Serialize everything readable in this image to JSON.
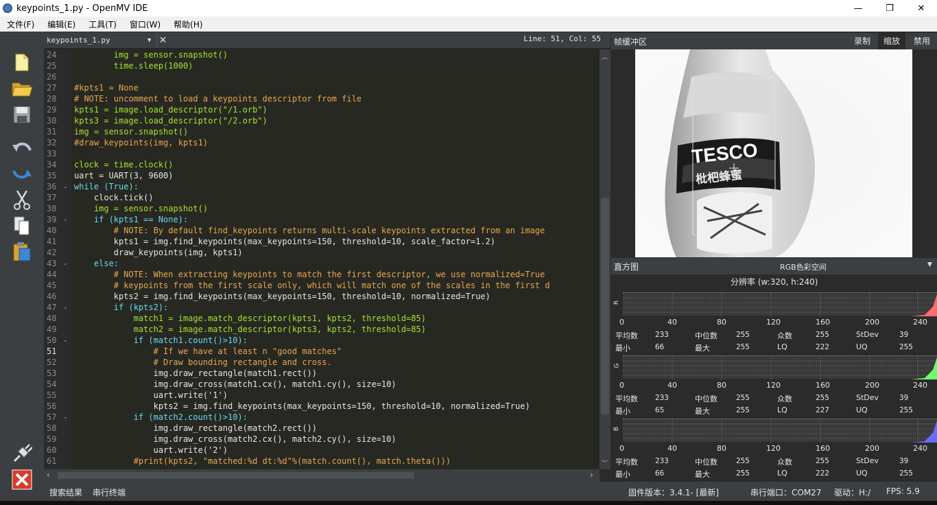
{
  "window": {
    "title": "keypoints_1.py - OpenMV IDE",
    "minimize": "—",
    "restore": "❐",
    "close": "✕"
  },
  "menu": [
    {
      "label": "文件(F)"
    },
    {
      "label": "编辑(E)"
    },
    {
      "label": "工具(T)"
    },
    {
      "label": "窗口(W)"
    },
    {
      "label": "帮助(H)"
    }
  ],
  "toolbar_icons": [
    "new-file-icon",
    "open-folder-icon",
    "save-icon",
    "undo-icon",
    "redo-icon",
    "cut-icon",
    "copy-icon",
    "paste-icon",
    "connect-icon",
    "disconnect-icon"
  ],
  "editor": {
    "file_tab": "keypoints_1.py",
    "close": "✕",
    "line_col": "Line: 51, Col: 55",
    "lines": [
      {
        "n": "24",
        "t": "        img = sensor.snapshot()"
      },
      {
        "n": "25",
        "t": "        time.sleep(1000)"
      },
      {
        "n": "26",
        "t": ""
      },
      {
        "n": "27",
        "t": "#kpts1 = None"
      },
      {
        "n": "28",
        "t": "# NOTE: uncomment to load a keypoints descriptor from file"
      },
      {
        "n": "29",
        "t": "kpts1 = image.load_descriptor(\"/1.orb\")"
      },
      {
        "n": "30",
        "t": "kpts3 = image.load_descriptor(\"/2.orb\")"
      },
      {
        "n": "31",
        "t": "img = sensor.snapshot()"
      },
      {
        "n": "32",
        "t": "#draw_keypoints(img, kpts1)"
      },
      {
        "n": "33",
        "t": ""
      },
      {
        "n": "34",
        "t": "clock = time.clock()"
      },
      {
        "n": "35",
        "t": "uart = UART(3, 9600)"
      },
      {
        "n": "36",
        "t": "while (True):"
      },
      {
        "n": "37",
        "t": "    clock.tick()"
      },
      {
        "n": "38",
        "t": "    img = sensor.snapshot()"
      },
      {
        "n": "39",
        "t": "    if (kpts1 == None):"
      },
      {
        "n": "40",
        "t": "        # NOTE: By default find_keypoints returns multi-scale keypoints extracted from an image"
      },
      {
        "n": "41",
        "t": "        kpts1 = img.find_keypoints(max_keypoints=150, threshold=10, scale_factor=1.2)"
      },
      {
        "n": "42",
        "t": "        draw_keypoints(img, kpts1)"
      },
      {
        "n": "43",
        "t": "    else:"
      },
      {
        "n": "44",
        "t": "        # NOTE: When extracting keypoints to match the first descriptor, we use normalized=True"
      },
      {
        "n": "45",
        "t": "        # keypoints from the first scale only, which will match one of the scales in the first d"
      },
      {
        "n": "46",
        "t": "        kpts2 = img.find_keypoints(max_keypoints=150, threshold=10, normalized=True)"
      },
      {
        "n": "47",
        "t": "        if (kpts2):"
      },
      {
        "n": "48",
        "t": "            match1 = image.match_descriptor(kpts1, kpts2, threshold=85)"
      },
      {
        "n": "49",
        "t": "            match2 = image.match_descriptor(kpts3, kpts2, threshold=85)"
      },
      {
        "n": "50",
        "t": "            if (match1.count()>10):"
      },
      {
        "n": "51",
        "t": "                # If we have at least n \"good matches\""
      },
      {
        "n": "52",
        "t": "                # Draw bounding rectangle and cross."
      },
      {
        "n": "53",
        "t": "                img.draw_rectangle(match1.rect())"
      },
      {
        "n": "54",
        "t": "                img.draw_cross(match1.cx(), match1.cy(), size=10)"
      },
      {
        "n": "55",
        "t": "                uart.write('1')"
      },
      {
        "n": "56",
        "t": "                kpts2 = img.find_keypoints(max_keypoints=150, threshold=10, normalized=True)"
      },
      {
        "n": "57",
        "t": "            if (match2.count()>10):"
      },
      {
        "n": "58",
        "t": "                img.draw_rectangle(match2.rect())"
      },
      {
        "n": "59",
        "t": "                img.draw_cross(match2.cx(), match2.cy(), size=10)"
      },
      {
        "n": "60",
        "t": "                uart.write('2')"
      },
      {
        "n": "61",
        "t": "            #print(kpts2, \"matched:%d dt:%d\"%(match.count(), match.theta()))"
      }
    ]
  },
  "framebuffer": {
    "label": "帧缓冲区",
    "record": "录制",
    "zoom": "缩放",
    "disable": "禁用",
    "brand_text": "TESCO",
    "product_text": "枇杷蜂蜜"
  },
  "histogram": {
    "label": "直方图",
    "colorspace": "RGB色彩空间",
    "resolution": "分辨率 (w:320, h:240)",
    "ticks": [
      "0",
      "40",
      "80",
      "120",
      "160",
      "200",
      "240"
    ],
    "stat_labels": {
      "mean": "平均数",
      "median": "中位数",
      "mode": "众数",
      "stdev": "StDev",
      "min": "最小",
      "max": "最大",
      "lq": "LQ",
      "uq": "UQ"
    },
    "channels": [
      {
        "name": "R",
        "color": "#ff6b6b",
        "mean": "233",
        "median": "255",
        "mode": "255",
        "stdev": "39",
        "min": "66",
        "max": "255",
        "lq": "222",
        "uq": "255"
      },
      {
        "name": "G",
        "color": "#6bff6b",
        "mean": "233",
        "median": "255",
        "mode": "255",
        "stdev": "39",
        "min": "65",
        "max": "255",
        "lq": "227",
        "uq": "255"
      },
      {
        "name": "B",
        "color": "#6b6bff",
        "mean": "233",
        "median": "255",
        "mode": "255",
        "stdev": "39",
        "min": "66",
        "max": "255",
        "lq": "222",
        "uq": "255"
      }
    ]
  },
  "status": {
    "search_results": "搜索结果",
    "serial_terminal": "串行终端",
    "firmware": "固件版本：3.4.1- [最新]",
    "serial_port": "串行端口：COM27",
    "drive": "驱动：H:/",
    "fps": "FPS:   5.9"
  }
}
